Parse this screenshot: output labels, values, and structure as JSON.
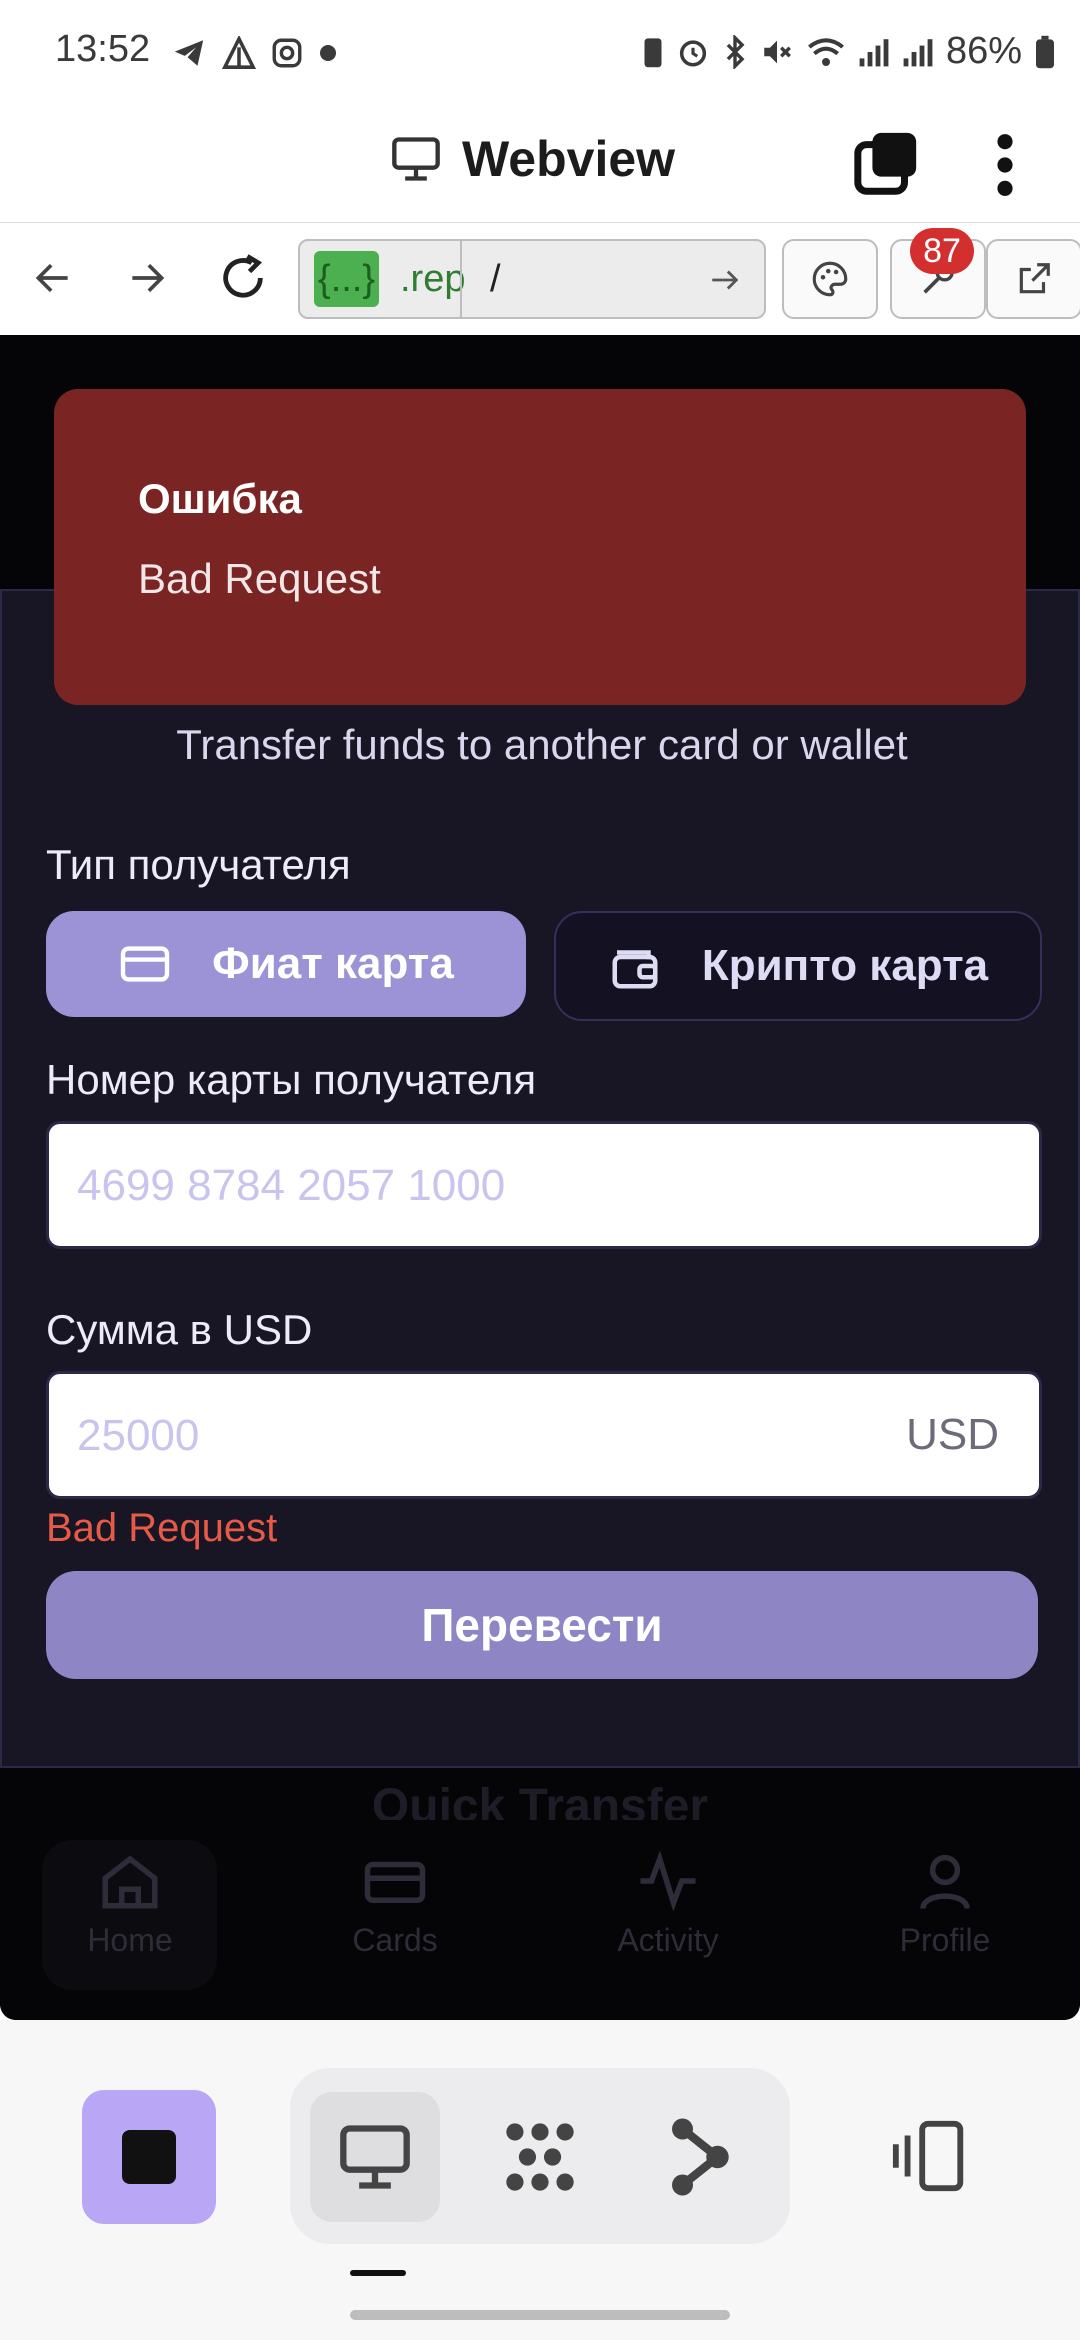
{
  "status_bar": {
    "time": "13:52",
    "battery": "86%"
  },
  "app_header": {
    "title": "Webview"
  },
  "url_bar": {
    "badge": "{...}",
    "host": ".rep",
    "path": "/",
    "notification_count": "87"
  },
  "error_toast": {
    "title": "Ошибка",
    "message": "Bad Request"
  },
  "transfer_form": {
    "subtitle": "Transfer funds to another card or wallet",
    "recipient_type_label": "Тип получателя",
    "fiat_button": "Фиат карта",
    "crypto_button": "Крипто карта",
    "card_number_label": "Номер карты получателя",
    "card_number_placeholder": "4699 8784 2057 1000",
    "amount_label": "Сумма в USD",
    "amount_placeholder": "25000",
    "amount_suffix": "USD",
    "error_text": "Bad Request",
    "submit_button": "Перевести"
  },
  "background_page": {
    "section_title": "Quick Transfer",
    "nav": [
      {
        "label": "Home",
        "icon": "home-icon"
      },
      {
        "label": "Cards",
        "icon": "card-icon"
      },
      {
        "label": "Activity",
        "icon": "activity-icon"
      },
      {
        "label": "Profile",
        "icon": "profile-icon"
      }
    ]
  },
  "colors": {
    "accent": "#9b93d6",
    "error_bg": "#7a2524",
    "error_text": "#e85a48",
    "modal_bg": "#181624"
  }
}
